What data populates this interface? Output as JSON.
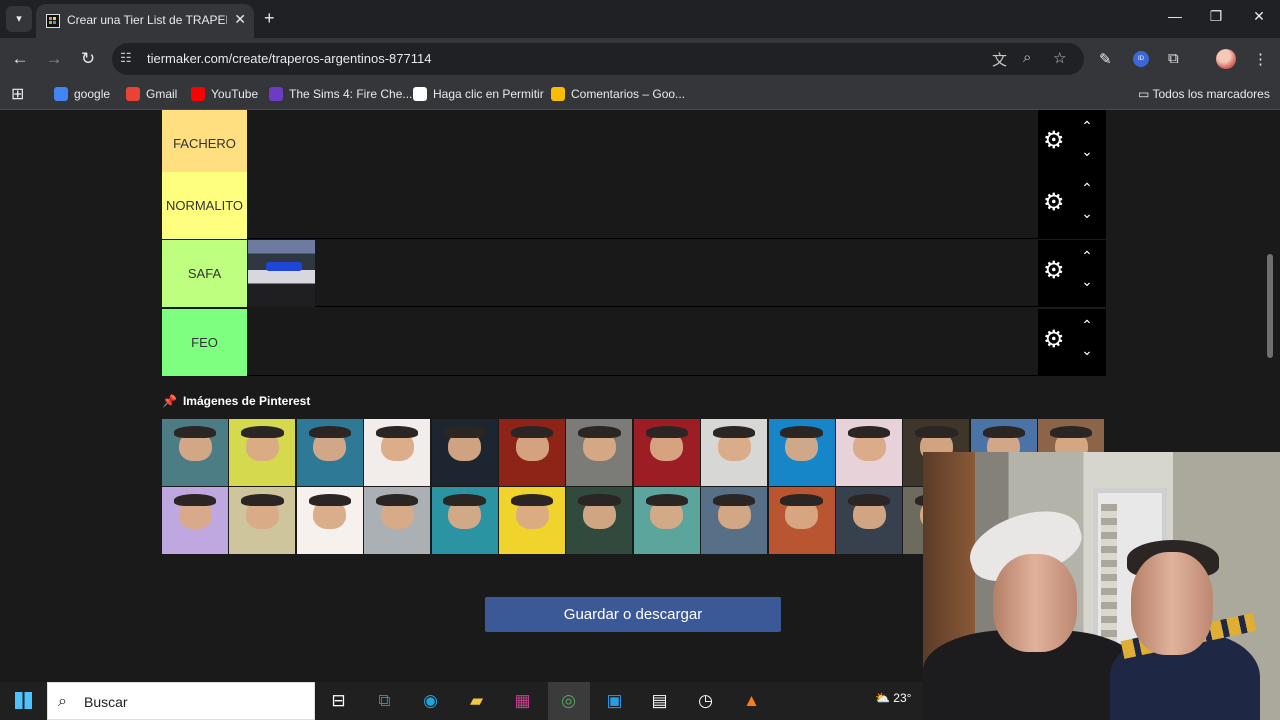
{
  "browser": {
    "tab_title": "Crear una Tier List de TRAPERO",
    "new_tab_symbol": "+",
    "close_symbol": "✕",
    "tab_menu_symbol": "▾",
    "window_controls": {
      "minimize": "—",
      "restore": "❐",
      "close": "✕"
    },
    "url": "tiermaker.com/create/traperos-argentinos-877114",
    "site_info_symbol": "☷",
    "nav_symbols": {
      "back": "←",
      "forward": "→",
      "reload": "↻"
    },
    "omnibox_icons": {
      "translate": "文",
      "zoom": "⌕",
      "star": "☆"
    },
    "extension_icons": {
      "pen": "✎",
      "badge": "ID",
      "puzzle": "⧉",
      "menu": "⋮"
    }
  },
  "bookmarks": {
    "apps_symbol": "⊞",
    "items": [
      {
        "label": "google",
        "color": "#4285f4"
      },
      {
        "label": "Gmail",
        "color": "#ea4335"
      },
      {
        "label": "YouTube",
        "color": "#ff0000"
      },
      {
        "label": "The Sims 4: Fire Che...",
        "color": "#6c3cc4"
      },
      {
        "label": "Haga clic en Permitir",
        "color": "#ffffff"
      },
      {
        "label": "Comentarios – Goo...",
        "color": "#fbbc05"
      }
    ],
    "all_bookmarks": "Todos los marcadores",
    "folder_symbol": "▭"
  },
  "tier_list": {
    "rows": [
      {
        "label": "FACHERO",
        "color": "#ffdf80",
        "has_item": false
      },
      {
        "label": "NORMALITO",
        "color": "#ffff7f",
        "has_item": false
      },
      {
        "label": "SAFA",
        "color": "#bfff7f",
        "has_item": true
      },
      {
        "label": "FEO",
        "color": "#7fff7f",
        "has_item": false
      }
    ],
    "controls": {
      "settings_symbol": "⚙",
      "up_symbol": "⌃",
      "down_symbol": "⌄"
    }
  },
  "gallery": {
    "heading": "Imágenes de Pinterest",
    "pin_symbol": "📌",
    "row_1_colors": [
      "#4c7c84",
      "#d5d94d",
      "#2e7995",
      "#f2ecea",
      "#1d2630",
      "#8e2318",
      "#7b7b78",
      "#9d1d24",
      "#d7d7d5",
      "#1686c8",
      "#e6d2d8",
      "#3e352b",
      "#4b73a5",
      "#8c6447"
    ],
    "row_2_colors": [
      "#bfa7df",
      "#cfc59d",
      "#f6f1ed",
      "#aab0b3",
      "#2a94a3",
      "#f0d42b",
      "#314a3d",
      "#5ca59d",
      "#587087",
      "#b95631",
      "#37404d",
      "#6d6b5d"
    ]
  },
  "actions": {
    "save_label": "Guardar o descargar"
  },
  "taskbar": {
    "search_placeholder": "Buscar",
    "search_symbol": "⌕",
    "icons": [
      {
        "name": "task-view-icon",
        "symbol": "⊟",
        "color": "#ffffff"
      },
      {
        "name": "outlook-icon",
        "symbol": "⧉",
        "color": "#2d7fe3"
      },
      {
        "name": "edge-icon",
        "symbol": "◉",
        "color": "#22a3e0"
      },
      {
        "name": "file-explorer-icon",
        "symbol": "▰",
        "color": "#f4c542"
      },
      {
        "name": "winrar-icon",
        "symbol": "▦",
        "color": "#c93f8d"
      },
      {
        "name": "chrome-icon",
        "symbol": "◎",
        "color": "#55a85d"
      },
      {
        "name": "store-icon",
        "symbol": "▣",
        "color": "#2a9de8"
      },
      {
        "name": "notepad-icon",
        "symbol": "▤",
        "color": "#ffffff"
      },
      {
        "name": "speedometer-icon",
        "symbol": "◷",
        "color": "#ffffff"
      },
      {
        "name": "antivirus-icon",
        "symbol": "▲",
        "color": "#ff7b16"
      }
    ],
    "weather_text": "23°",
    "weather_symbol": "⛅"
  },
  "webcam_overlay": {
    "visible": true
  }
}
